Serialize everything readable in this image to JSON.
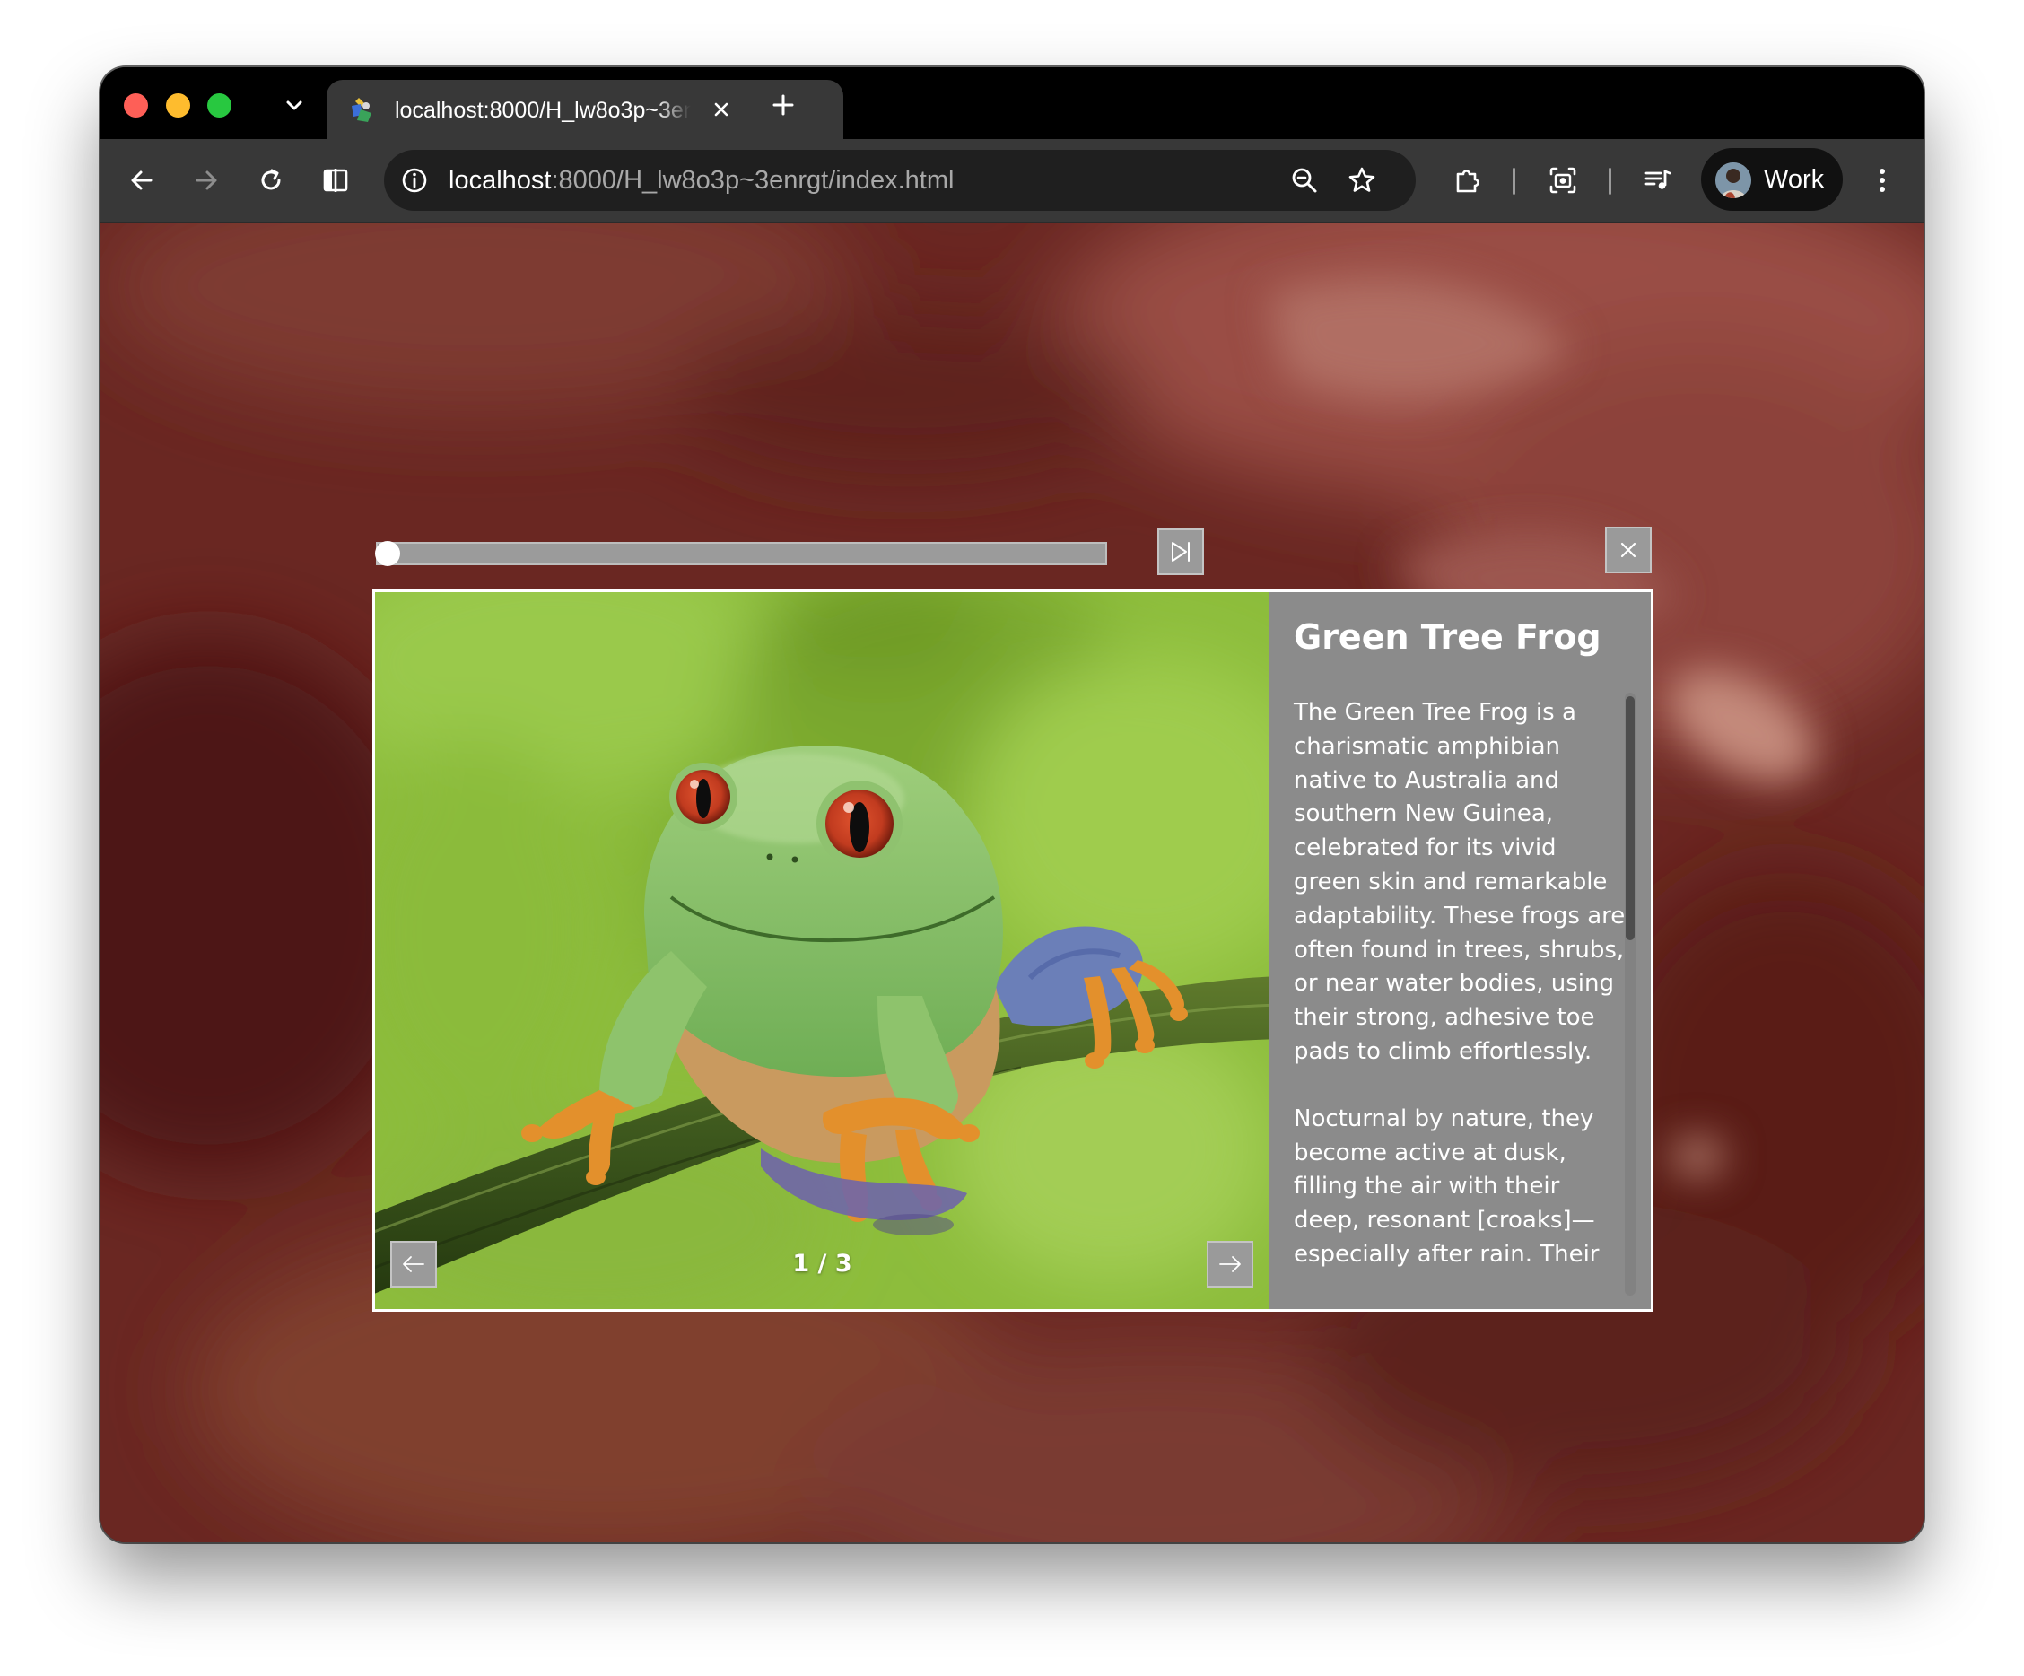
{
  "browser": {
    "tab_title": "localhost:8000/H_lw8o3p~3enrgt/index.html",
    "url_host": "localhost",
    "url_rest": ":8000/H_lw8o3p~3enrgt/index.html",
    "profile_label": "Work"
  },
  "viewer": {
    "title": "Green Tree Frog",
    "paragraphs": [
      "The Green Tree Frog is a charismatic amphibian native to Australia and southern New Guinea, celebrated for its vivid green skin and remarkable adaptability. These frogs are often found in trees, shrubs, or near water bodies, using their strong, adhesive toe pads to climb effortlessly.",
      "Nocturnal by nature, they become active at dusk, filling the air with their deep, resonant [croaks]—especially after rain. Their"
    ],
    "counter": "1 / 3",
    "slideshow_progress": 0.0,
    "description_scroll_fraction": 0.0
  },
  "icons": {
    "tab_dropdown": "chevron-down-icon",
    "tab_close": "close-icon",
    "new_tab": "plus-icon",
    "back": "arrow-left-icon",
    "forward": "arrow-right-icon",
    "reload": "reload-icon",
    "split_view": "split-view-icon",
    "site_info": "info-icon",
    "zoom": "zoom-icon",
    "bookmark": "star-icon",
    "extensions": "puzzle-icon",
    "screenshot": "camera-icon",
    "media": "media-queue-icon",
    "menu": "kebab-menu-icon",
    "play": "play-next-icon",
    "close_viewer": "close-icon",
    "prev": "arrow-left-icon",
    "next": "arrow-right-icon"
  },
  "colors": {
    "page_background": "#6d2823",
    "panel_background": "#8b8b8b",
    "button_background": "#9a9a9a",
    "photo_green": "#8dbd3c"
  }
}
